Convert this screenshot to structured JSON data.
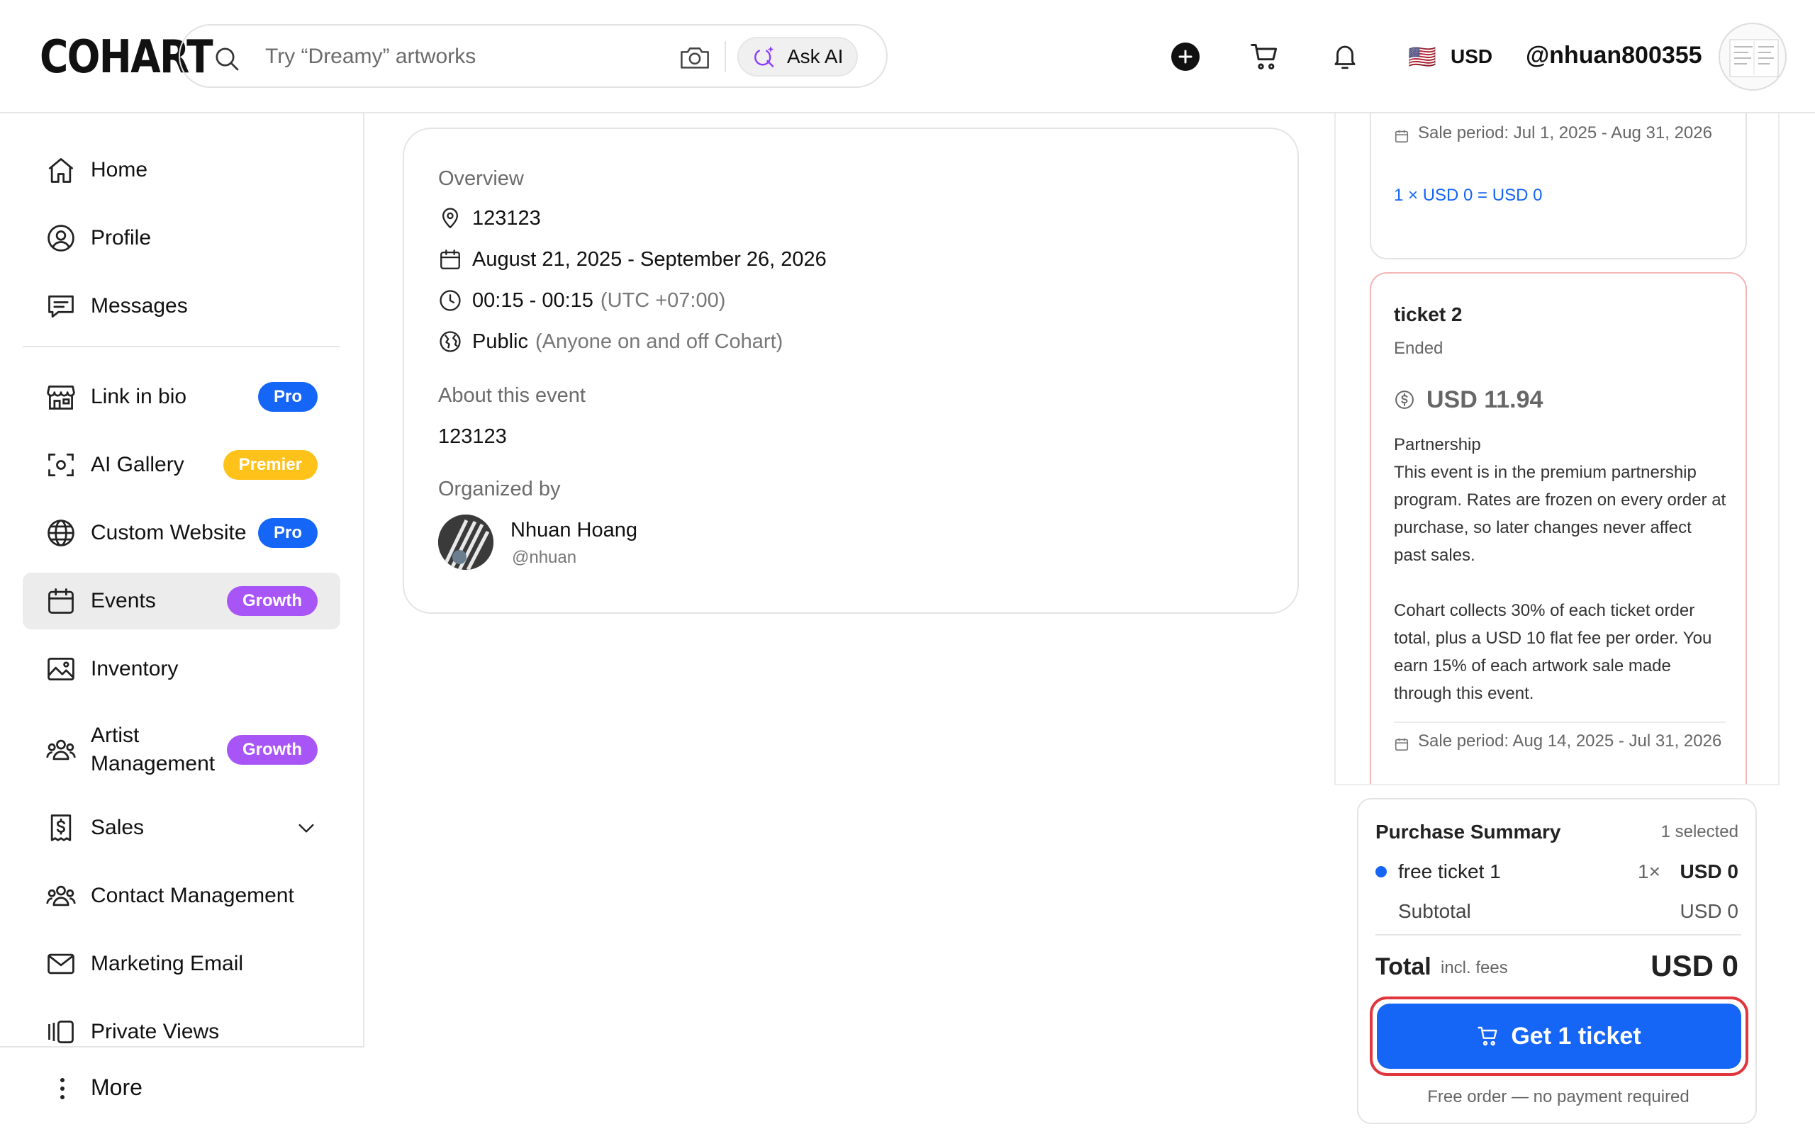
{
  "header": {
    "logo": "COHART",
    "search_placeholder": "Try “Dreamy” artworks",
    "ask_ai_label": "Ask AI",
    "flag": "🇺🇸",
    "currency": "USD",
    "username": "@nhuan800355"
  },
  "sidebar": {
    "items": [
      {
        "label": "Home",
        "icon": "home-icon"
      },
      {
        "label": "Profile",
        "icon": "profile-icon"
      },
      {
        "label": "Messages",
        "icon": "messages-icon"
      },
      {
        "label": "Link in bio",
        "icon": "storefront-icon",
        "badge": "Pro"
      },
      {
        "label": "AI Gallery",
        "icon": "ai-scan-icon",
        "badge": "Premier"
      },
      {
        "label": "Custom Website",
        "icon": "globe-icon",
        "badge": "Pro"
      },
      {
        "label": "Events",
        "icon": "calendar-icon",
        "badge": "Growth",
        "active": true
      },
      {
        "label": "Inventory",
        "icon": "image-icon"
      },
      {
        "label": "Artist\nManagement",
        "icon": "group-icon",
        "badge": "Growth"
      },
      {
        "label": "Sales",
        "icon": "dollar-doc-icon"
      },
      {
        "label": "Contact Management",
        "icon": "contacts-icon"
      },
      {
        "label": "Marketing Email",
        "icon": "mail-icon"
      },
      {
        "label": "Private Views",
        "icon": "private-views-icon"
      }
    ],
    "more_label": "More"
  },
  "event": {
    "overview_heading": "Overview",
    "location": "123123",
    "dates": "August 21, 2025 - September 26, 2026",
    "time": "00:15 - 00:15",
    "timezone": "(UTC +07:00)",
    "visibility": "Public",
    "visibility_note": "(Anyone on and off Cohart)",
    "about_heading": "About this event",
    "about_text": "123123",
    "organized_heading": "Organized by",
    "organizer_name": "Nhuan Hoang",
    "organizer_handle": "@nhuan"
  },
  "tickets": [
    {
      "sale_period": "Sale period: Jul 1, 2025 - Aug 31, 2026",
      "calc": "1 × USD 0 = USD 0"
    },
    {
      "name": "ticket 2",
      "status": "Ended",
      "price": "USD 11.94",
      "description": "Partnership\nThis event is in the premium partnership program. Rates are frozen on every order at purchase, so later changes never affect past sales.\n\nCohart collects 30% of each ticket order total, plus a USD 10 flat fee per order. You earn 15% of each artwork sale made through this event.",
      "sale_period": "Sale period: Aug 14, 2025 - Jul 31, 2026"
    }
  ],
  "summary": {
    "title": "Purchase Summary",
    "selected_count": "1 selected",
    "item_name": "free ticket 1",
    "item_qty": "1×",
    "item_price": "USD 0",
    "subtotal_label": "Subtotal",
    "subtotal_value": "USD 0",
    "total_label": "Total",
    "fees_label": "incl. fees",
    "total_value": "USD 0",
    "button_label": "Get 1 ticket",
    "note": "Free order — no payment required"
  },
  "colors": {
    "accent": "#1565f6",
    "pro_badge": "#1565f6",
    "premier_badge": "#ffc21a",
    "growth_badge": "#a855f7",
    "focus_ring": "#e0363c"
  }
}
